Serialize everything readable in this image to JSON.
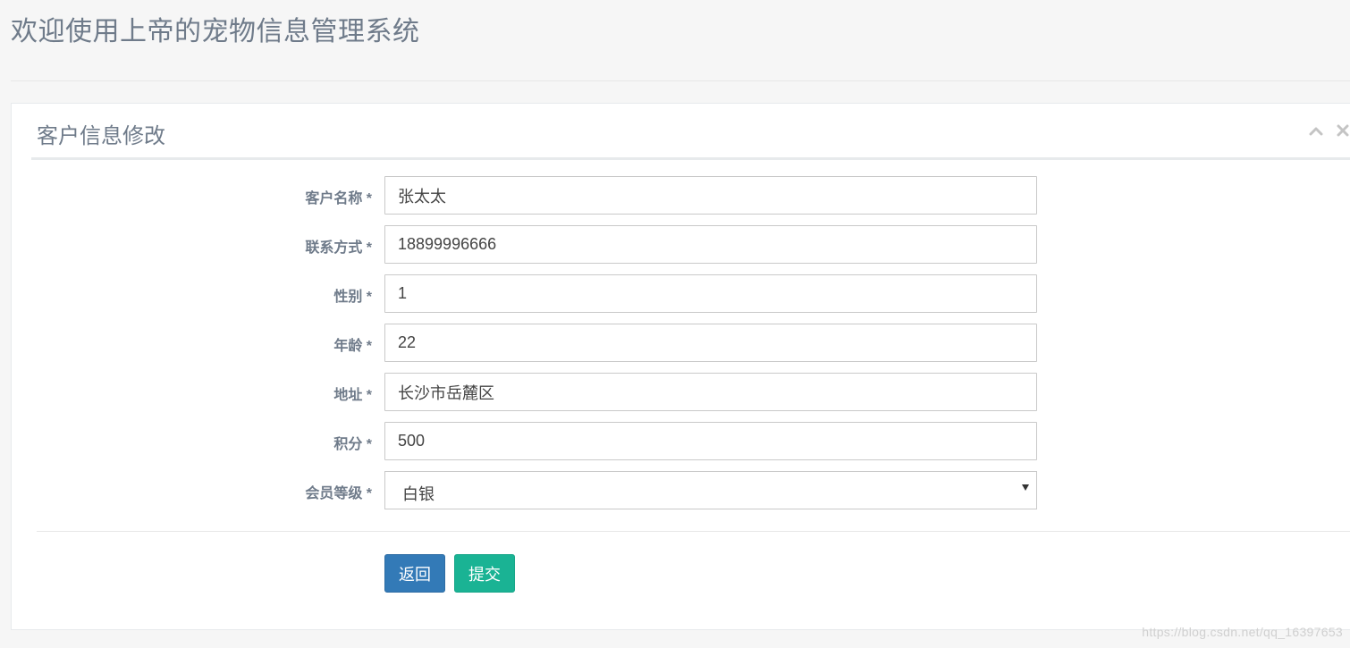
{
  "page": {
    "title": "欢迎使用上帝的宠物信息管理系统"
  },
  "panel": {
    "title": "客户信息修改",
    "tools": {
      "collapse_icon": "chevron-up-icon",
      "close_icon": "close-icon"
    }
  },
  "form": {
    "fields": [
      {
        "label": "客户名称 *",
        "value": "张太太"
      },
      {
        "label": "联系方式 *",
        "value": "18899996666"
      },
      {
        "label": "性别 *",
        "value": "1"
      },
      {
        "label": "年龄 *",
        "value": "22"
      },
      {
        "label": "地址 *",
        "value": "长沙市岳麓区"
      },
      {
        "label": "积分 *",
        "value": "500"
      }
    ],
    "member_level": {
      "label": "会员等级 *",
      "selected": "白银"
    },
    "buttons": {
      "back_label": "返回",
      "submit_label": "提交"
    }
  },
  "watermark": "https://blog.csdn.net/qq_16397653",
  "colors": {
    "back_button": "#337ab7",
    "submit_button": "#1ab394",
    "title_text": "#6f7b8a"
  }
}
